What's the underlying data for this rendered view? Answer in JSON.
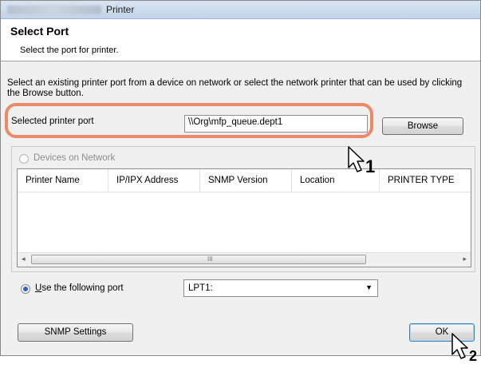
{
  "window": {
    "title": "Printer"
  },
  "header": {
    "title": "Select Port",
    "subtitle": "Select the port for printer."
  },
  "instruction": "Select an existing printer port from a device on network or select the network printer that can be used by clicking the Browse button.",
  "selected_port": {
    "label": "Selected printer port",
    "value": "\\\\Org\\mfp_queue.dept1",
    "browse_button": "Browse"
  },
  "devices": {
    "radio_label": "Devices on Network",
    "columns": [
      "Printer Name",
      "IP/IPX Address",
      "SNMP Version",
      "Location",
      "PRINTER TYPE"
    ],
    "scroll_left": "◂",
    "scroll_right": "▸",
    "scroll_grip": "III"
  },
  "use_port": {
    "radio_label": "Use the following port",
    "selected": "LPT1:"
  },
  "footer": {
    "snmp_button": "SNMP Settings",
    "ok_button": "OK"
  },
  "callouts": {
    "step1": "1",
    "step2": "2"
  },
  "colors": {
    "highlight": "#ea8a66",
    "radio_selected": "#2c62c9"
  }
}
